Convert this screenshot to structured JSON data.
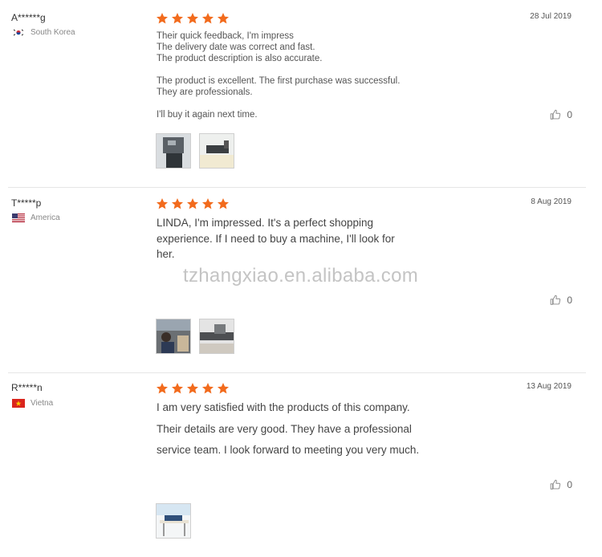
{
  "colors": {
    "star": "#f26b1d",
    "divider": "#e6e6e6"
  },
  "watermark": "tzhangxiao.en.alibaba.com",
  "reviews": [
    {
      "user": "A******g",
      "country": "South Korea",
      "flag_icon": "south-korea-flag-icon",
      "rating": 5,
      "date": "28 Jul 2019",
      "lines": [
        "Their quick feedback, I'm impress",
        "The delivery date was correct and fast.",
        "The product description is also accurate.",
        "",
        "The product is excellent. The first purchase was successful.",
        "They are professionals.",
        "",
        "I'll buy it again next time."
      ],
      "likes": "0",
      "photos": 2
    },
    {
      "user": "T*****p",
      "country": "America",
      "flag_icon": "usa-flag-icon",
      "rating": 5,
      "date": "8 Aug 2019",
      "lines": [
        "LINDA, I'm impressed. It's a perfect shopping",
        "experience. If I need to buy a machine, I'll look for",
        "her."
      ],
      "likes": "0",
      "photos": 2
    },
    {
      "user": "R*****n",
      "country": "Vietna",
      "flag_icon": "vietnam-flag-icon",
      "rating": 5,
      "date": "13 Aug 2019",
      "lines": [
        "I am very satisfied with the products of this company.",
        "Their details are very good. They have a professional",
        "service team. I look forward to meeting you very much."
      ],
      "likes": "0",
      "photos": 1
    }
  ]
}
